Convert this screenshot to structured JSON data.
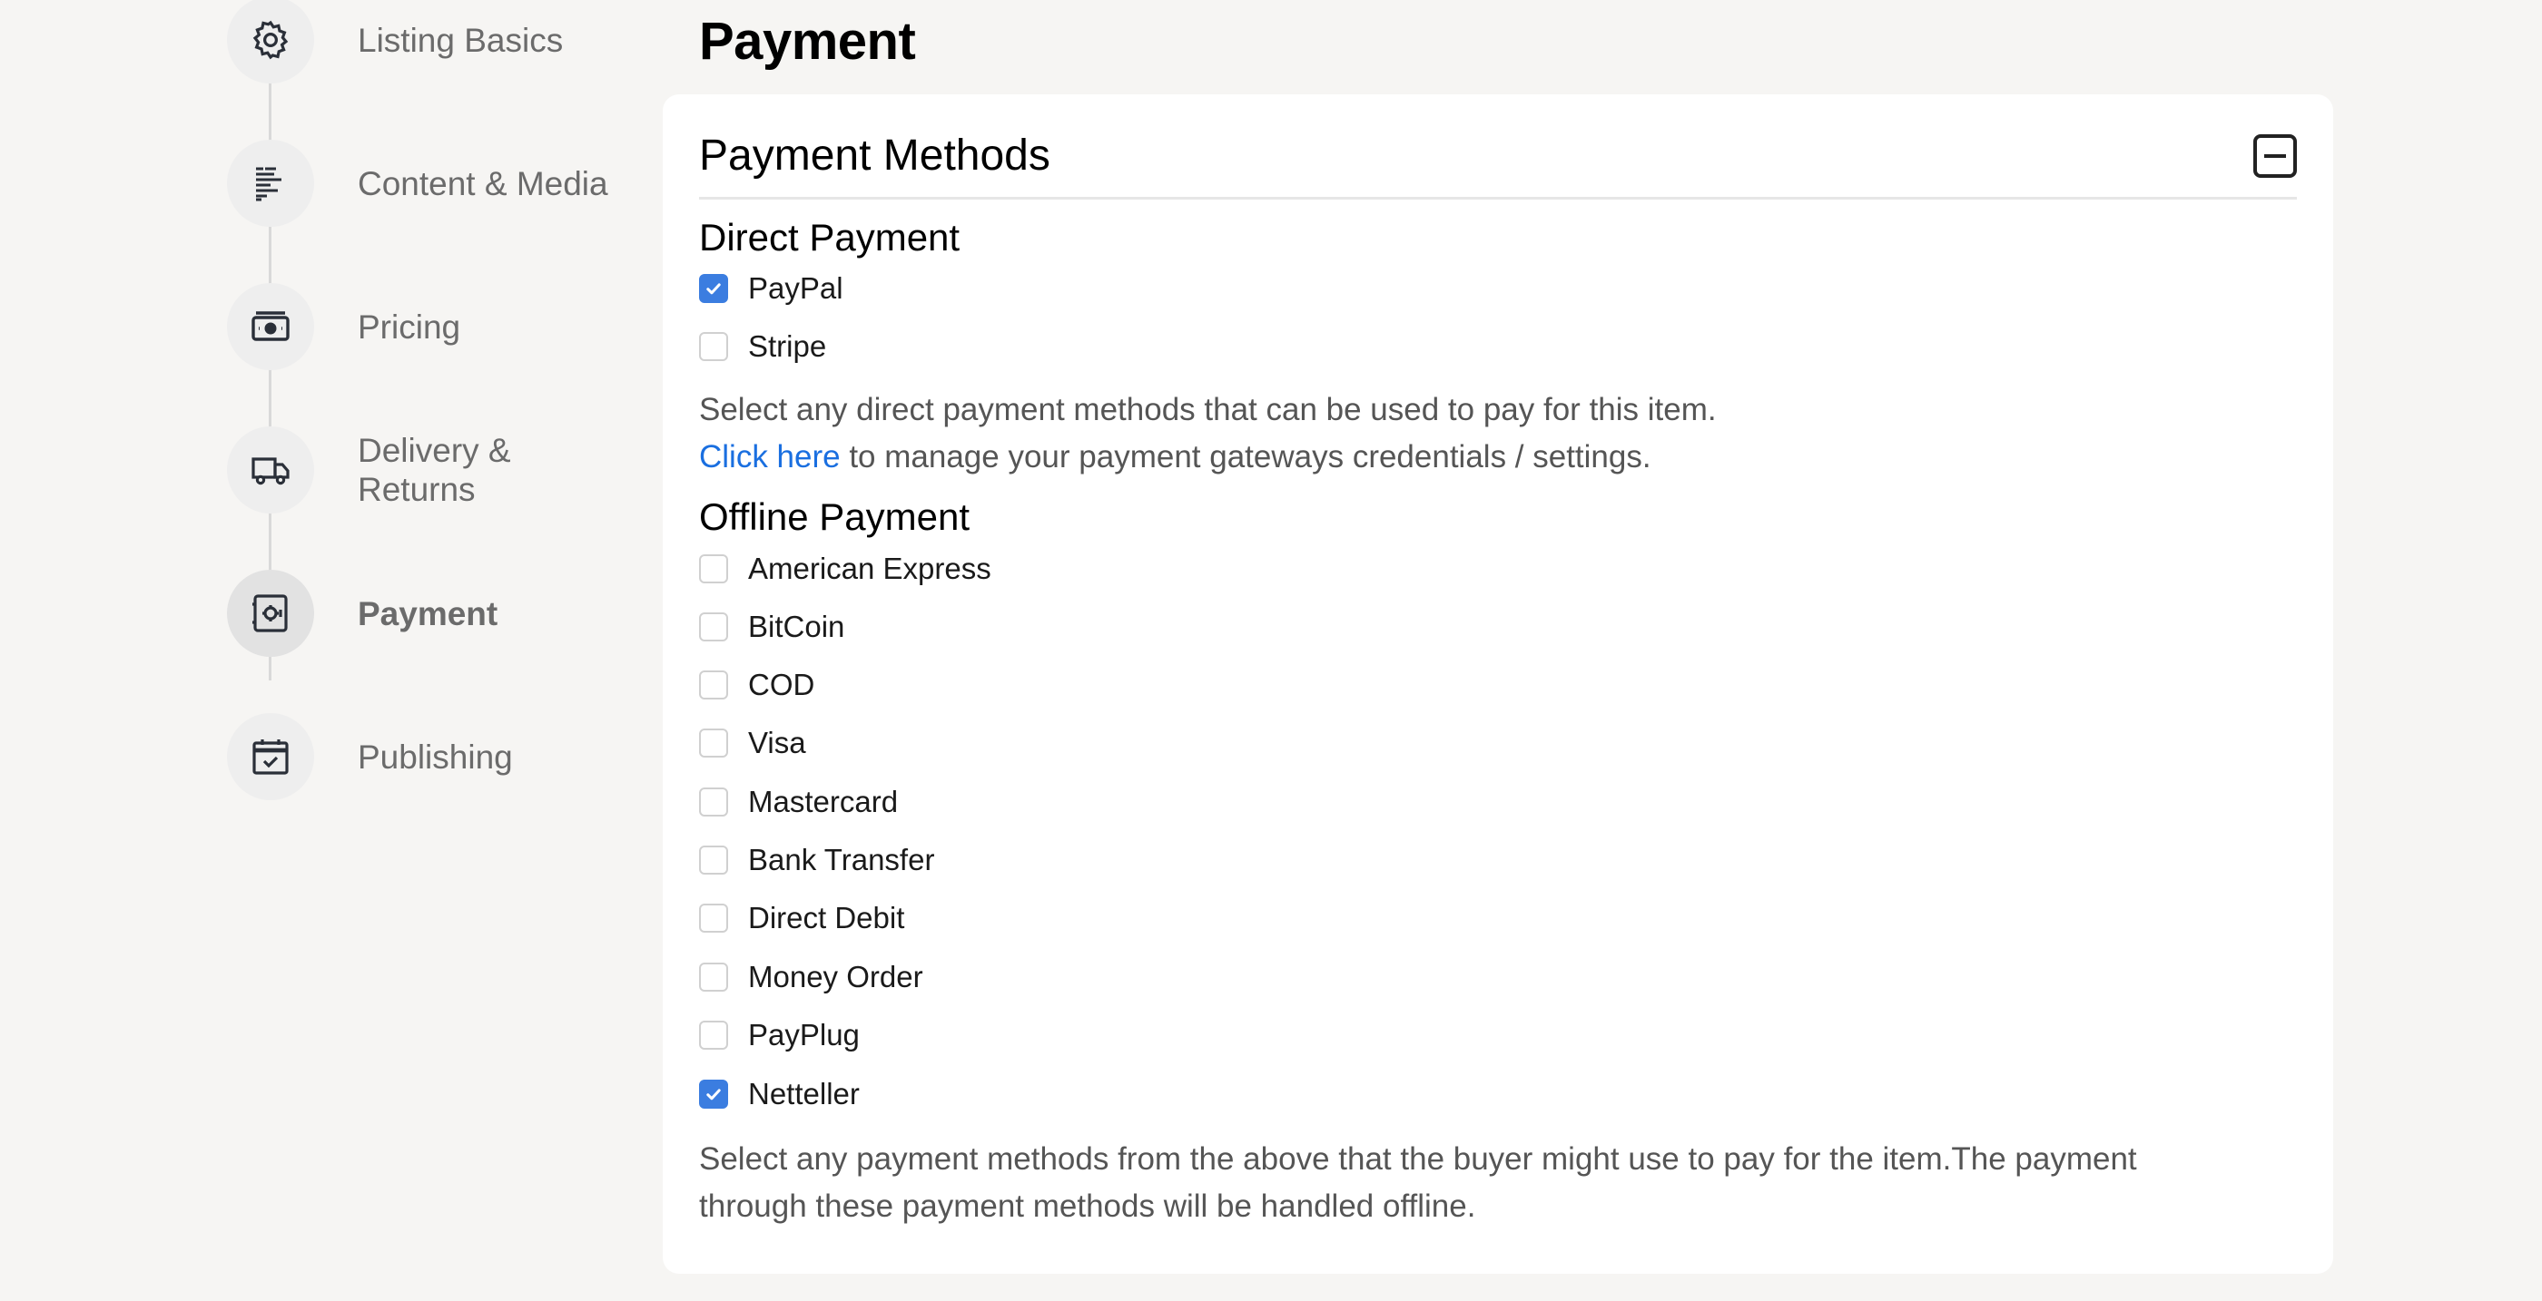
{
  "sidebar": {
    "steps": [
      {
        "label": "Listing Basics",
        "icon": "gear-icon",
        "active": false
      },
      {
        "label": "Content & Media",
        "icon": "text-lines-icon",
        "active": false
      },
      {
        "label": "Pricing",
        "icon": "banknote-icon",
        "active": false
      },
      {
        "label": "Delivery & Returns",
        "icon": "truck-icon",
        "active": false
      },
      {
        "label": "Payment",
        "icon": "safe-icon",
        "active": true
      },
      {
        "label": "Publishing",
        "icon": "calendar-check-icon",
        "active": false
      }
    ]
  },
  "page": {
    "title": "Payment"
  },
  "card": {
    "title": "Payment Methods",
    "collapse_icon": "minus-square-icon"
  },
  "direct": {
    "title": "Direct Payment",
    "options": [
      {
        "label": "PayPal",
        "checked": true
      },
      {
        "label": "Stripe",
        "checked": false
      }
    ],
    "help": "Select any direct payment methods that can be used to pay for this item.",
    "link_text": "Click here",
    "link_suffix": " to manage your payment gateways credentials / settings."
  },
  "offline": {
    "title": "Offline Payment",
    "options": [
      {
        "label": "American Express",
        "checked": false
      },
      {
        "label": "BitCoin",
        "checked": false
      },
      {
        "label": "COD",
        "checked": false
      },
      {
        "label": "Visa",
        "checked": false
      },
      {
        "label": "Mastercard",
        "checked": false
      },
      {
        "label": "Bank Transfer",
        "checked": false
      },
      {
        "label": "Direct Debit",
        "checked": false
      },
      {
        "label": "Money Order",
        "checked": false
      },
      {
        "label": "PayPlug",
        "checked": false
      },
      {
        "label": "Netteller",
        "checked": true
      }
    ],
    "help_line1": "Select any payment methods from the above that the buyer might use to pay for the item.The payment",
    "help_line2": "through these payment methods will be handled offline."
  },
  "colors": {
    "accent": "#3b7de0",
    "link": "#1a6fe0",
    "background": "#f6f5f3"
  }
}
